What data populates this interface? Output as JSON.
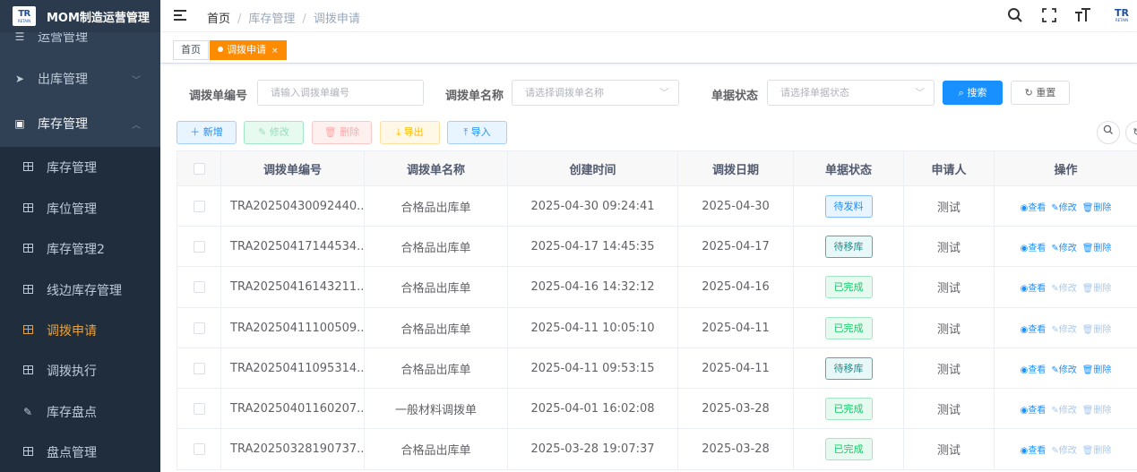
{
  "app": {
    "logo_mark": "TR",
    "logo_sub": "RETAIN",
    "title": "MOM制造运营管理"
  },
  "sidebar": {
    "partial_top": "运营管理",
    "items": [
      {
        "label": "出库管理",
        "icon": "send-icon",
        "type": "top"
      },
      {
        "label": "库存管理",
        "icon": "monitor-icon",
        "type": "top-open"
      },
      {
        "label": "库存管理",
        "icon": "grid-icon",
        "type": "sub"
      },
      {
        "label": "库位管理",
        "icon": "grid-icon",
        "type": "sub"
      },
      {
        "label": "库存管理2",
        "icon": "grid-icon",
        "type": "sub"
      },
      {
        "label": "线边库存管理",
        "icon": "grid-icon",
        "type": "sub"
      },
      {
        "label": "调拨申请",
        "icon": "grid-icon",
        "type": "sub-active"
      },
      {
        "label": "调拨执行",
        "icon": "grid-icon",
        "type": "sub"
      },
      {
        "label": "库存盘点",
        "icon": "edit-icon",
        "type": "sub"
      },
      {
        "label": "盘点管理",
        "icon": "grid-icon",
        "type": "sub"
      }
    ]
  },
  "header": {
    "breadcrumb": [
      "首页",
      "库存管理",
      "调拨申请"
    ]
  },
  "tags": {
    "home": "首页",
    "active": "调拨申请",
    "close": "×"
  },
  "search": {
    "code_label": "调拨单编号",
    "code_placeholder": "请输入调拨单编号",
    "name_label": "调拨单名称",
    "name_placeholder": "请选择调拨单名称",
    "status_label": "单据状态",
    "status_placeholder": "请选择单据状态",
    "search_btn": "搜索",
    "reset_btn": "重置"
  },
  "toolbar": {
    "add": "新增",
    "edit": "修改",
    "delete": "删除",
    "export": "导出",
    "import": "导入"
  },
  "table": {
    "columns": [
      "调拨单编号",
      "调拨单名称",
      "创建时间",
      "调拨日期",
      "单据状态",
      "申请人",
      "操作"
    ],
    "ops": {
      "view": "查看",
      "edit": "修改",
      "delete": "删除"
    },
    "rows": [
      {
        "code": "TRA20250430092440...",
        "name": "合格品出库单",
        "created": "2025-04-30 09:24:41",
        "date": "2025-04-30",
        "status": "待发料",
        "status_kind": "info",
        "user": "测试",
        "editable": true
      },
      {
        "code": "TRA20250417144534...",
        "name": "合格品出库单",
        "created": "2025-04-17 14:45:35",
        "date": "2025-04-17",
        "status": "待移库",
        "status_kind": "teal",
        "user": "测试",
        "editable": true
      },
      {
        "code": "TRA20250416143211...",
        "name": "合格品出库单",
        "created": "2025-04-16 14:32:12",
        "date": "2025-04-16",
        "status": "已完成",
        "status_kind": "green",
        "user": "测试",
        "editable": false
      },
      {
        "code": "TRA20250411100509...",
        "name": "合格品出库单",
        "created": "2025-04-11 10:05:10",
        "date": "2025-04-11",
        "status": "已完成",
        "status_kind": "green",
        "user": "测试",
        "editable": false
      },
      {
        "code": "TRA20250411095314...",
        "name": "合格品出库单",
        "created": "2025-04-11 09:53:15",
        "date": "2025-04-11",
        "status": "待移库",
        "status_kind": "teal",
        "user": "测试",
        "editable": true
      },
      {
        "code": "TRA20250401160207...",
        "name": "一般材料调拨单",
        "created": "2025-04-01 16:02:08",
        "date": "2025-03-28",
        "status": "已完成",
        "status_kind": "green",
        "user": "测试",
        "editable": false
      },
      {
        "code": "TRA20250328190737...",
        "name": "合格品出库单",
        "created": "2025-03-28 19:07:37",
        "date": "2025-03-28",
        "status": "已完成",
        "status_kind": "green",
        "user": "测试",
        "editable": false
      }
    ]
  }
}
